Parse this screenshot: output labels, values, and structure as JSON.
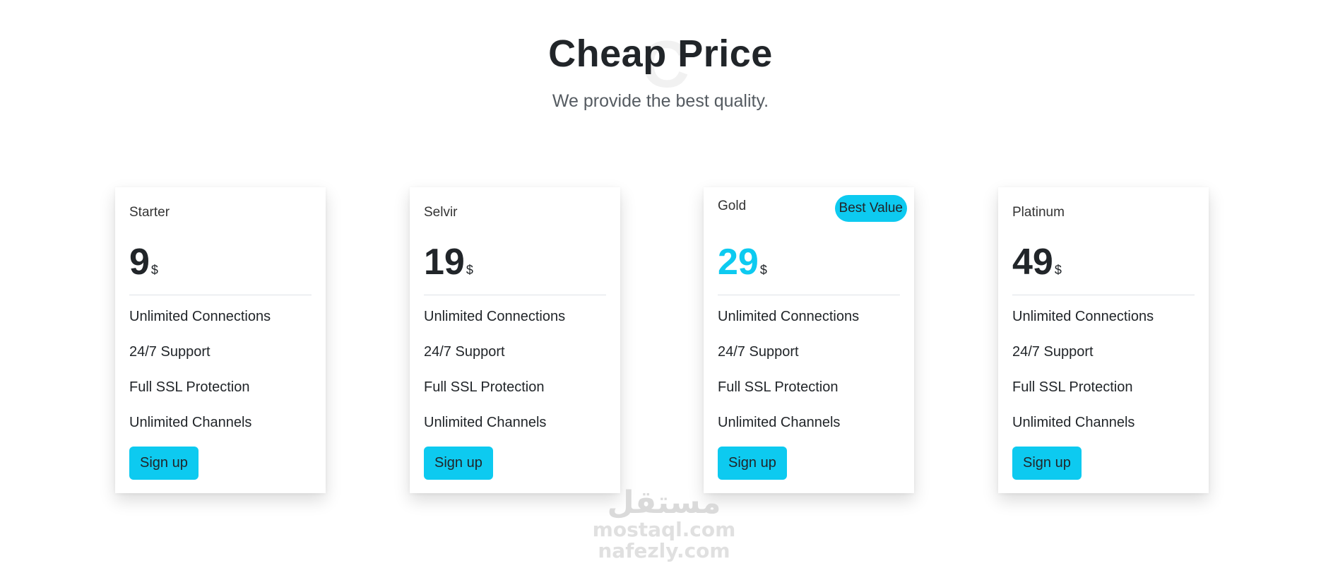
{
  "header": {
    "title": "Cheap Price",
    "subtitle": "We provide the best quality.",
    "background_letter": "C"
  },
  "colors": {
    "accent": "#0dcaf0",
    "text": "#212529",
    "divider": "#dee2e6"
  },
  "plans": [
    {
      "name": "Starter",
      "price": "9",
      "currency": "$",
      "features": [
        "Unlimited Connections",
        "24/7 Support",
        "Full SSL Protection",
        "Unlimited Channels"
      ],
      "cta": "Sign up"
    },
    {
      "name": "Selvir",
      "price": "19",
      "currency": "$",
      "features": [
        "Unlimited Connections",
        "24/7 Support",
        "Full SSL Protection",
        "Unlimited Channels"
      ],
      "cta": "Sign up"
    },
    {
      "name": "Gold",
      "badge": "Best Value",
      "price": "29",
      "currency": "$",
      "features": [
        "Unlimited Connections",
        "24/7 Support",
        "Full SSL Protection",
        "Unlimited Channels"
      ],
      "cta": "Sign up"
    },
    {
      "name": "Platinum",
      "price": "49",
      "currency": "$",
      "features": [
        "Unlimited Connections",
        "24/7 Support",
        "Full SSL Protection",
        "Unlimited Channels"
      ],
      "cta": "Sign up"
    }
  ],
  "watermark": {
    "logo": "مستقل",
    "site1": "mostaql.com",
    "site2": "nafezly.com"
  }
}
